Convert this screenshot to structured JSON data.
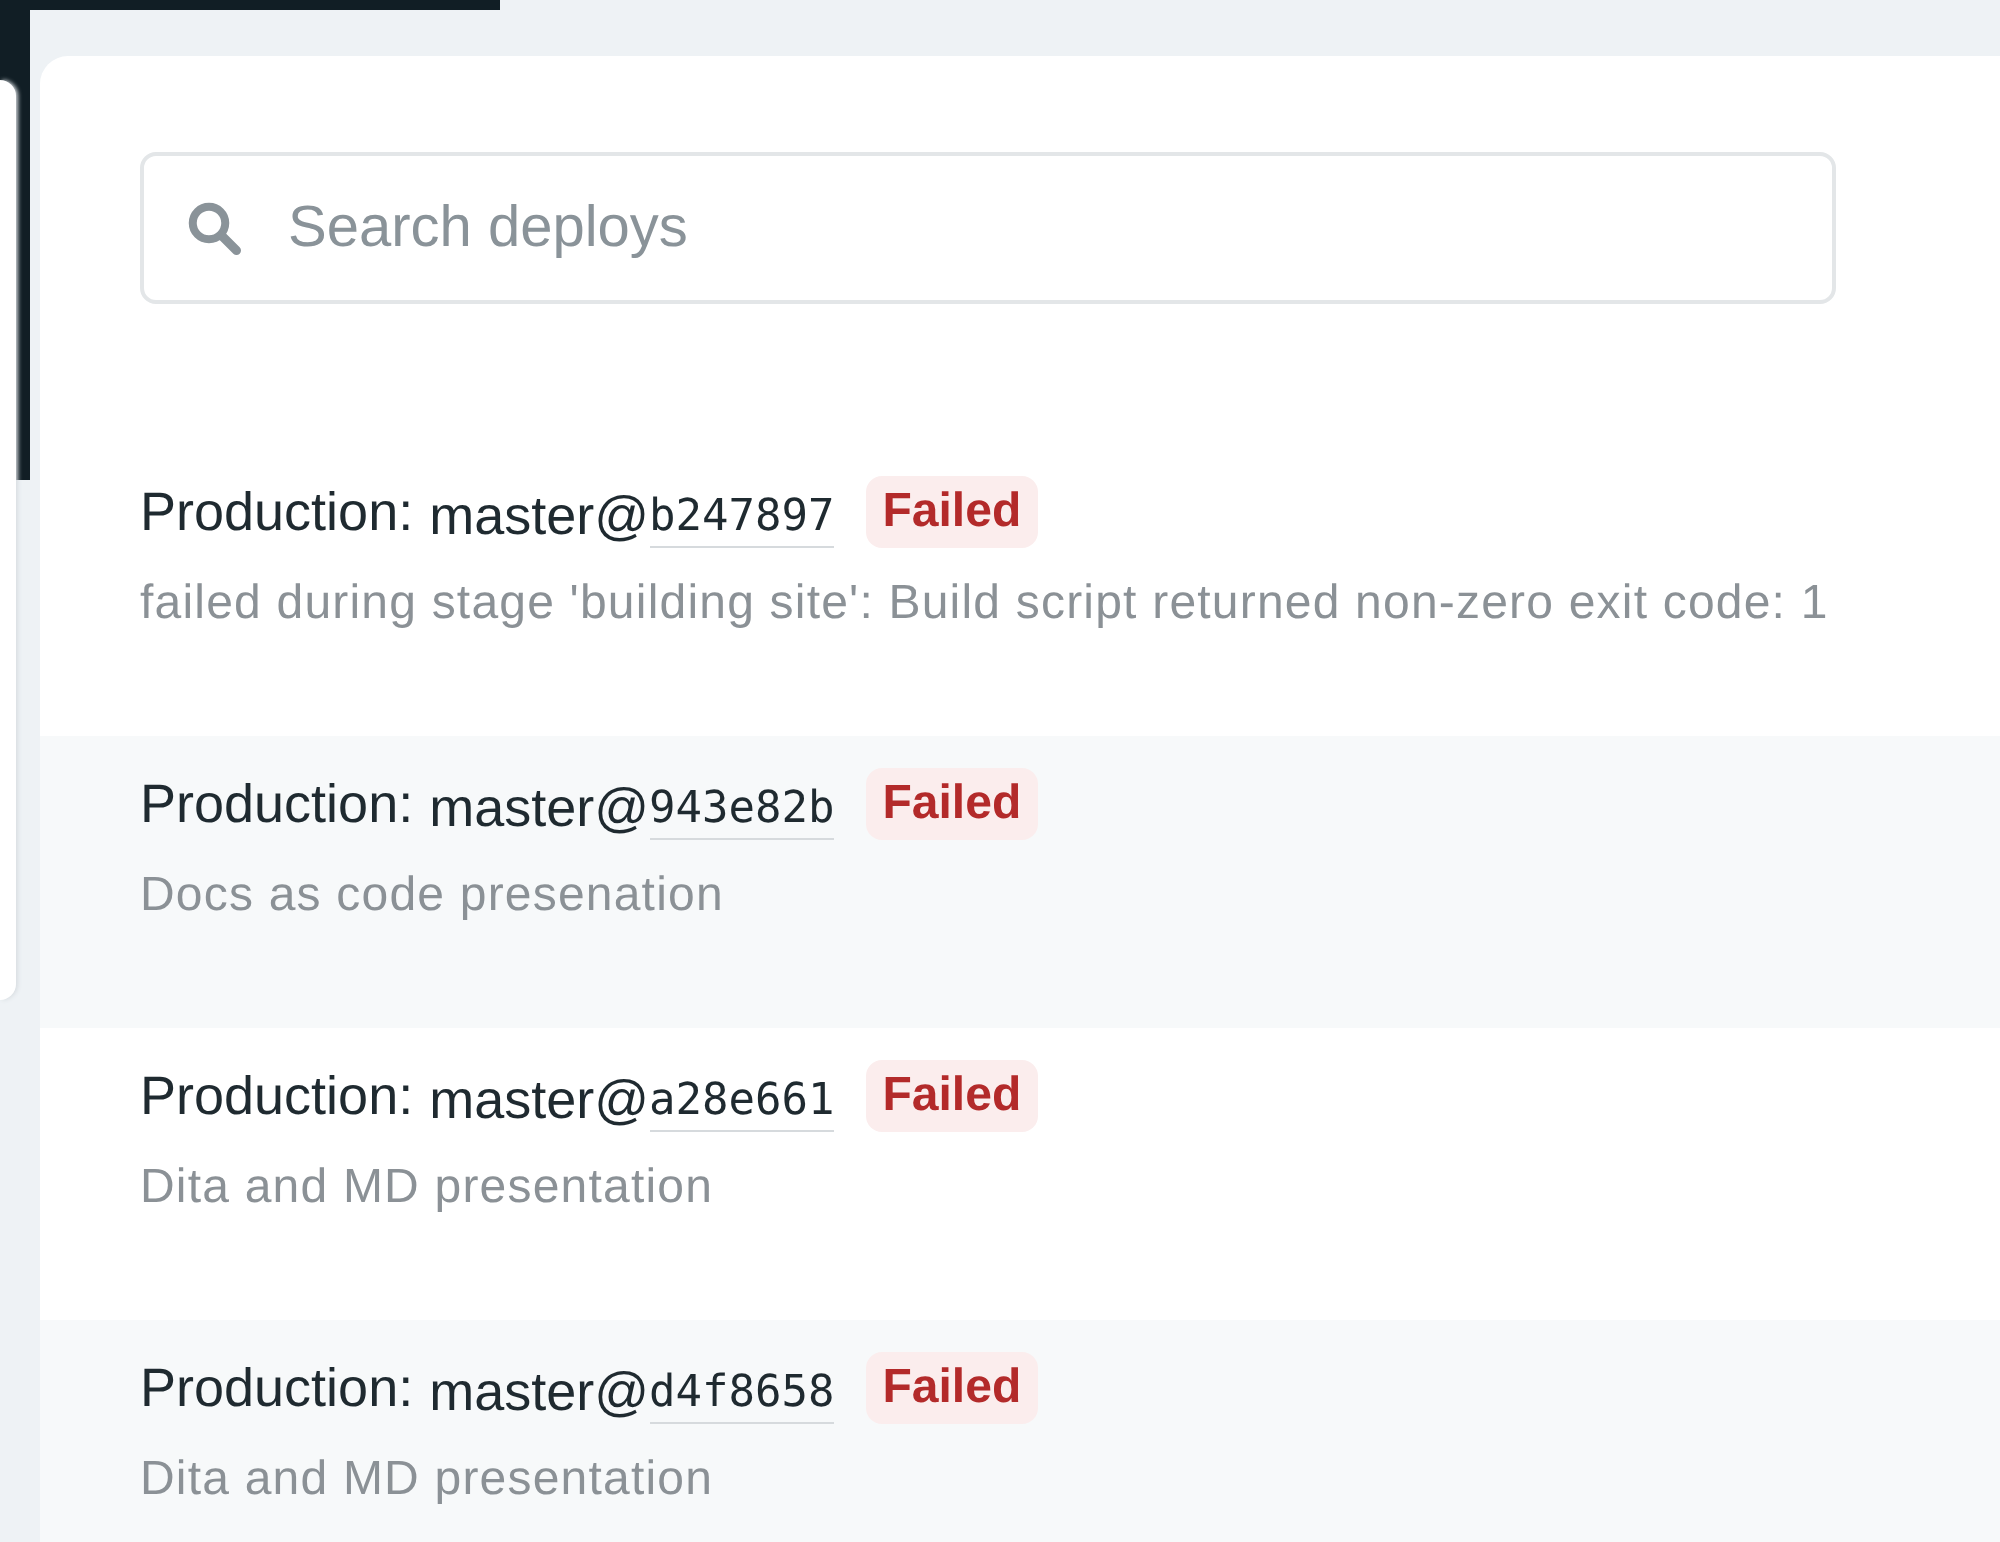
{
  "search": {
    "placeholder": "Search deploys"
  },
  "deploys": [
    {
      "context": "Production:",
      "branch": "master@",
      "commit": "b247897",
      "status": {
        "kind": "failed",
        "label": "Failed"
      },
      "message": "failed during stage 'building site': Build script returned non-zero exit code: 1"
    },
    {
      "context": "Production:",
      "branch": "master@",
      "commit": "943e82b",
      "status": {
        "kind": "failed",
        "label": "Failed"
      },
      "message": "Docs as code presenation"
    },
    {
      "context": "Production:",
      "branch": "master@",
      "commit": "a28e661",
      "status": {
        "kind": "failed",
        "label": "Failed"
      },
      "message": "Dita and MD presentation"
    },
    {
      "context": "Production:",
      "branch": "master@",
      "commit": "d4f8658",
      "status": {
        "kind": "failed",
        "label": "Failed"
      },
      "message": "Dita and MD presentation"
    }
  ]
}
